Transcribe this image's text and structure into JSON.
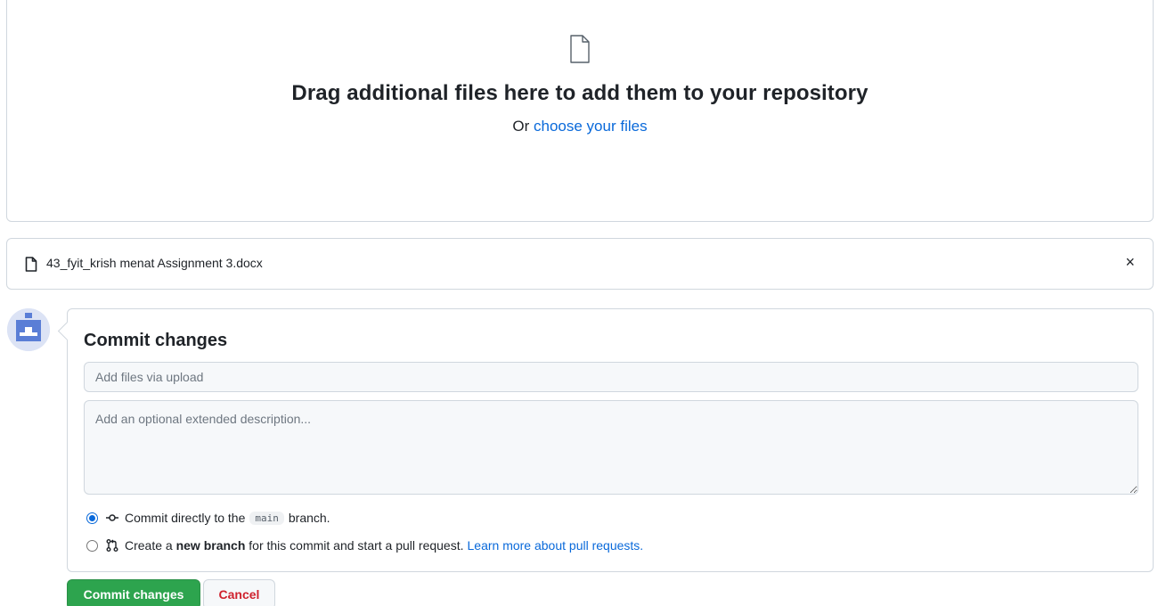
{
  "dropzone": {
    "title": "Drag additional files here to add them to your repository",
    "sub_prefix": "Or",
    "sub_link": "choose your files"
  },
  "file": {
    "name": "43_fyit_krish menat Assignment 3.docx",
    "close": "×"
  },
  "commit": {
    "title": "Commit changes",
    "summary_placeholder": "Add files via upload",
    "description_placeholder": "Add an optional extended description...",
    "option_direct": {
      "prefix": "Commit directly to the",
      "branch": "main",
      "suffix": "branch.",
      "checked": true
    },
    "option_new": {
      "prefix": "Create a",
      "bold": "new branch",
      "suffix": "for this commit and start a pull request.",
      "link": "Learn more about pull requests.",
      "checked": false
    }
  },
  "buttons": {
    "commit": "Commit changes",
    "cancel": "Cancel"
  },
  "colors": {
    "accent": "#0969da",
    "primary_button": "#2da44e",
    "danger": "#cf222e",
    "border": "#d0d7de"
  }
}
